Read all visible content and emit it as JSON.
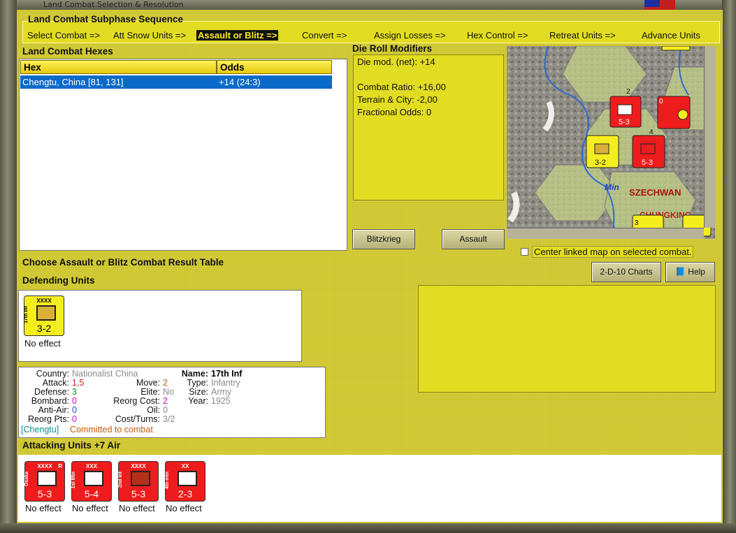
{
  "window": {
    "title": "Land Combat Selection & Resolution"
  },
  "sequence": {
    "title": "Land Combat Subphase Sequence",
    "steps": [
      "Select Combat =>",
      "Att Snow Units =>",
      "Assault or Blitz =>",
      "Convert =>",
      "Assign Losses =>",
      "Hex Control =>",
      "Retreat Units =>",
      "Advance Units"
    ],
    "active_step": "Assault or Blitz =>"
  },
  "hexes": {
    "title": "Land Combat Hexes",
    "columns": [
      "Hex",
      "Odds"
    ],
    "rows": [
      {
        "hex": "Chengtu, China [81, 131]",
        "odds": "+14 (24:3)"
      }
    ]
  },
  "modifiers": {
    "title": "Die Roll Modifiers",
    "lines": [
      "Die mod. (net): +14",
      "",
      "Combat Ratio: +16,00",
      "Terrain & City: -2,00",
      "Fractional Odds: 0"
    ]
  },
  "buttons": {
    "blitz": "Blitzkrieg",
    "assault": "Assault",
    "charts": "2-D-10 Charts",
    "help": "Help"
  },
  "center_map_label": "Center linked map on selected combat.",
  "choose_label": "Choose Assault or Blitz Combat Result Table",
  "map": {
    "labels": [
      "Min",
      "SZECHWAN",
      "CHUNGKING"
    ],
    "unit_numbers": [
      "2",
      "4",
      "0",
      "3"
    ]
  },
  "defending": {
    "title": "Defending Units",
    "units": [
      {
        "name": "17th Inf",
        "size": "XXXX",
        "strength": "3-2",
        "effect": "No effect"
      }
    ]
  },
  "info": {
    "country_k": "Country:",
    "country_v": "Nationalist China",
    "attack_k": "Attack:",
    "attack_v": "1,5",
    "defense_k": "Defense:",
    "defense_v": "3",
    "bombard_k": "Bombard:",
    "bombard_v": "0",
    "antiair_k": "Anti-Air:",
    "antiair_v": "0",
    "reorg_k": "Reorg Pts:",
    "reorg_v": "0",
    "move_k": "Move:",
    "move_v": "2",
    "elite_k": "Elite:",
    "elite_v": "No",
    "reorgcost_k": "Reorg Cost:",
    "reorgcost_v": "2",
    "oil_k": "Oil:",
    "oil_v": "0",
    "cost_k": "Cost/Turns:",
    "cost_v": "3/2",
    "name_k": "Name:",
    "name_v": "17th Inf",
    "type_k": "Type:",
    "type_v": "Infantry",
    "size_k": "Size:",
    "size_v": "Army",
    "year_k": "Year:",
    "year_v": "1925",
    "location": "[Chengtu]",
    "status": "Committed to combat"
  },
  "attacking": {
    "title": "Attacking Units +7 Air",
    "units": [
      {
        "name": "Osaka",
        "size": "XXXX",
        "flag": "R",
        "strength": "5-3",
        "effect": "No effect"
      },
      {
        "name": "1st Mtn",
        "size": "XXX",
        "strength": "5-4",
        "effect": "No effect"
      },
      {
        "name": "2nd Inf",
        "size": "XXXX",
        "strength": "5-3",
        "effect": "No effect"
      },
      {
        "name": "4th mtn",
        "size": "XX",
        "strength": "2-3",
        "effect": "No effect"
      }
    ]
  },
  "colors": {
    "panel": "#cdc531",
    "highlight": "#0a6ac9",
    "japan_red": "#ee1c1c",
    "china_yellow": "#f5ee1e"
  }
}
